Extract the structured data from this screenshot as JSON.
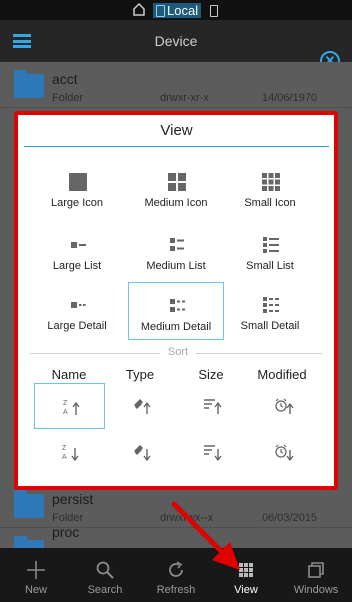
{
  "status_bar": {
    "local_label": "Local",
    "icons": [
      "home-icon",
      "sdcard-icon",
      "phone-icon"
    ]
  },
  "app_bar": {
    "title": "Device",
    "menu_icon": "hamburger-icon",
    "close_icon": "close-circle-icon",
    "accent_color": "#33a8e5"
  },
  "files": [
    {
      "name": "acct",
      "type": "Folder",
      "permissions": "drwxr-xr-x",
      "modified": "14/06/1970"
    },
    {
      "name": "persist",
      "type": "Folder",
      "permissions": "drwxrwx--x",
      "modified": "06/03/2015"
    },
    {
      "name": "proc",
      "type": "",
      "permissions": "",
      "modified": ""
    }
  ],
  "dialog": {
    "title": "View",
    "view_options": [
      {
        "label": "Large Icon",
        "icon": "large-icon-grid-icon",
        "selected": false
      },
      {
        "label": "Medium Icon",
        "icon": "medium-icon-grid-icon",
        "selected": false
      },
      {
        "label": "Small Icon",
        "icon": "small-icon-grid-icon",
        "selected": false
      },
      {
        "label": "Large List",
        "icon": "large-list-icon",
        "selected": false
      },
      {
        "label": "Medium List",
        "icon": "medium-list-icon",
        "selected": false
      },
      {
        "label": "Small List",
        "icon": "small-list-icon",
        "selected": false
      },
      {
        "label": "Large Detail",
        "icon": "large-detail-icon",
        "selected": false
      },
      {
        "label": "Medium Detail",
        "icon": "medium-detail-icon",
        "selected": true
      },
      {
        "label": "Small Detail",
        "icon": "small-detail-icon",
        "selected": false
      }
    ],
    "sort_label": "Sort",
    "sort_columns": [
      {
        "header": "Name",
        "asc_icon": "name-ascending-icon",
        "desc_icon": "name-descending-icon",
        "selected": "asc"
      },
      {
        "header": "Type",
        "asc_icon": "type-ascending-icon",
        "desc_icon": "type-descending-icon",
        "selected": ""
      },
      {
        "header": "Size",
        "asc_icon": "size-ascending-icon",
        "desc_icon": "size-descending-icon",
        "selected": ""
      },
      {
        "header": "Modified",
        "asc_icon": "modified-ascending-icon",
        "desc_icon": "modified-descending-icon",
        "selected": ""
      }
    ],
    "frame_color": "#e00000",
    "selection_color": "#6cc2ea"
  },
  "bottom_bar": [
    {
      "label": "New",
      "icon": "plus-icon",
      "active": false
    },
    {
      "label": "Search",
      "icon": "search-icon",
      "active": false
    },
    {
      "label": "Refresh",
      "icon": "refresh-icon",
      "active": false
    },
    {
      "label": "View",
      "icon": "grid-view-icon",
      "active": true
    },
    {
      "label": "Windows",
      "icon": "windows-icon",
      "active": false
    }
  ],
  "annotation": {
    "icon": "red-arrow-icon",
    "color": "#e00000"
  }
}
